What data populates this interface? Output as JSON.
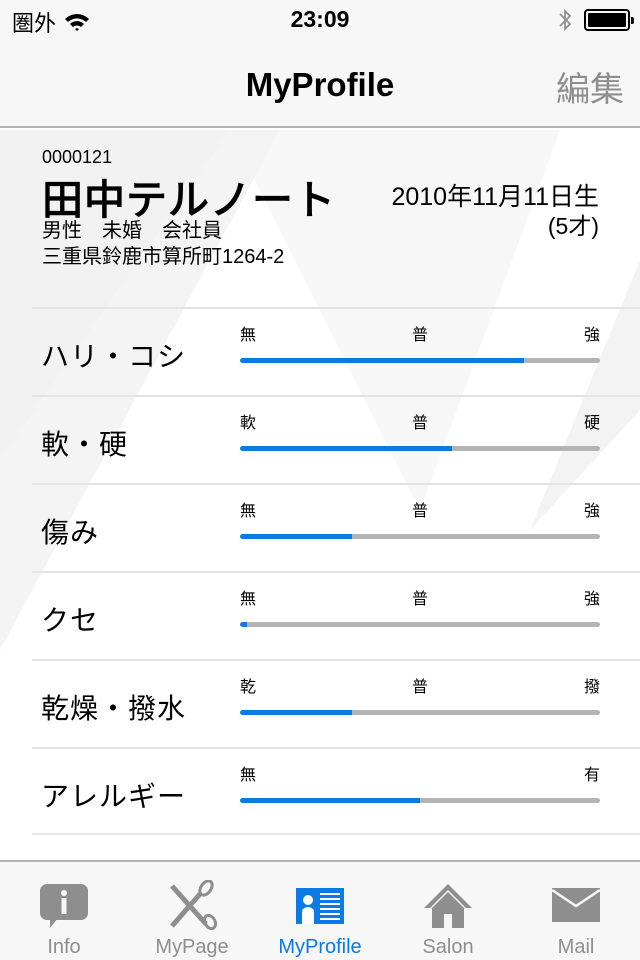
{
  "status_bar": {
    "carrier": "圏外",
    "wifi_icon": "wifi-icon",
    "time": "23:09",
    "bluetooth_icon": "bluetooth-icon",
    "battery_icon": "battery-icon",
    "battery_level": 1.0
  },
  "nav": {
    "title": "MyProfile",
    "edit_label": "編集"
  },
  "profile": {
    "member_id": "0000121",
    "name": "田中テルノート",
    "attributes": "男性　未婚　会社員",
    "address": "三重県鈴鹿市算所町1264-2",
    "birth_date": "2010年11月11日生",
    "age": "(5才)"
  },
  "hair_metrics": [
    {
      "label": "ハリ・コシ",
      "scale": [
        "無",
        "普",
        "強"
      ],
      "value": 0.79
    },
    {
      "label": "軟・硬",
      "scale": [
        "軟",
        "普",
        "硬"
      ],
      "value": 0.59
    },
    {
      "label": "傷み",
      "scale": [
        "無",
        "普",
        "強"
      ],
      "value": 0.31
    },
    {
      "label": "クセ",
      "scale": [
        "無",
        "普",
        "強"
      ],
      "value": 0.02
    },
    {
      "label": "乾燥・撥水",
      "scale": [
        "乾",
        "普",
        "撥"
      ],
      "value": 0.31
    },
    {
      "label": "アレルギー",
      "scale": [
        "無",
        "",
        "有"
      ],
      "value": 0.5
    }
  ],
  "colors": {
    "accent": "#0a7ae6",
    "track": "#b4b4b4",
    "inactive": "#8e8e8e"
  },
  "tab_bar": {
    "active_index": 2,
    "tabs": [
      {
        "label": "Info",
        "icon": "info-icon"
      },
      {
        "label": "MyPage",
        "icon": "scissors-icon"
      },
      {
        "label": "MyProfile",
        "icon": "profile-card-icon"
      },
      {
        "label": "Salon",
        "icon": "home-icon"
      },
      {
        "label": "Mail",
        "icon": "mail-icon"
      }
    ]
  }
}
